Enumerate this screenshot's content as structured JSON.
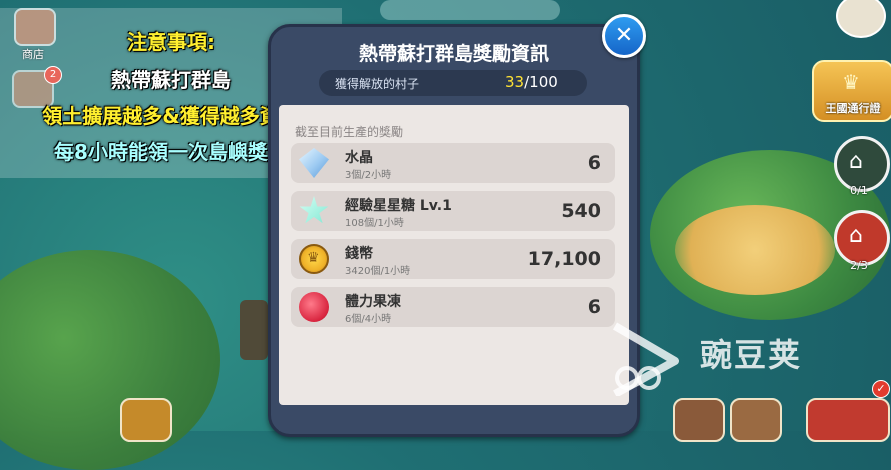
{
  "notice": {
    "title": "注意事項:",
    "line1": "熱帶蘇打群島",
    "line2": "領土擴展越多&獲得越多資源",
    "line3": "每8小時能領一次島嶼獎勵"
  },
  "left_buttons": {
    "shop_label": "商店",
    "badge": "2"
  },
  "right_buttons": {
    "pass_label": "王國通行證",
    "counter1": "0/1",
    "counter2": "2/3"
  },
  "panel": {
    "title": "熱帶蘇打群島獎勵資訊",
    "villages_label": "獲得解放的村子",
    "villages_current": "33",
    "villages_total": "/100",
    "section_label": "截至目前生產的獎勵",
    "rewards": [
      {
        "name": "水晶",
        "rate": "3個/2小時",
        "amount": "6",
        "icon": "crystal-icon"
      },
      {
        "name": "經驗星星糖 Lv.1",
        "rate": "108個/1小時",
        "amount": "540",
        "icon": "star-candy-icon"
      },
      {
        "name": "錢幣",
        "rate": "3420個/1小時",
        "amount": "17,100",
        "icon": "coin-icon"
      },
      {
        "name": "體力果凍",
        "rate": "6個/4小時",
        "amount": "6",
        "icon": "jelly-icon"
      }
    ]
  },
  "watermark": "豌豆荚",
  "colors": {
    "panel_header": "#3a4a66",
    "panel_body": "#ece7e4",
    "highlight_yellow": "#ffe234",
    "close_blue": "#1f7fe0"
  }
}
